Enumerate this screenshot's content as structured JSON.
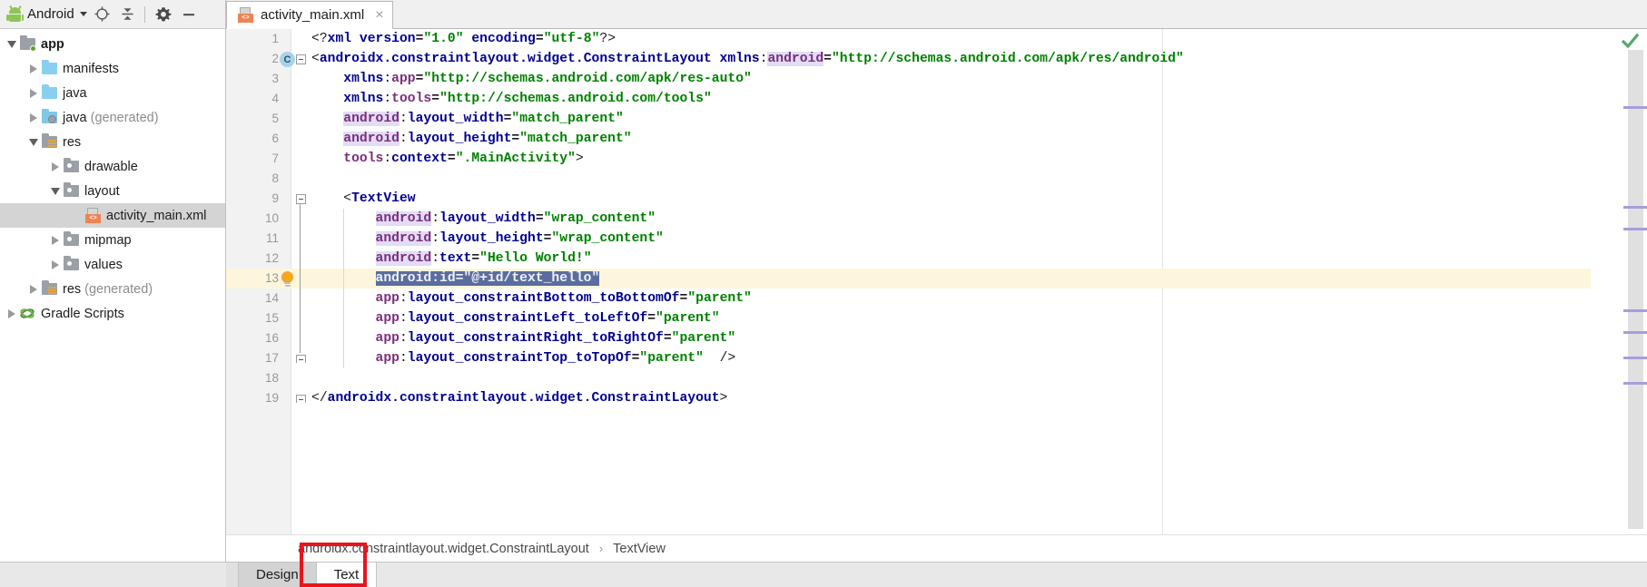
{
  "window": {
    "left_panel_title": "Android"
  },
  "project_toolbar": {
    "label": "Android",
    "icons": [
      "android-bot-icon",
      "chevron-down-icon",
      "locate-target-icon",
      "collapse-all-icon",
      "settings-gear-icon",
      "hide-panel-icon"
    ]
  },
  "project_tree": [
    {
      "label": "app",
      "sub": "",
      "depth": 0,
      "state": "expanded",
      "icon": "folder-module",
      "bold": true,
      "selected": false
    },
    {
      "label": "manifests",
      "sub": "",
      "depth": 1,
      "state": "collapsed",
      "icon": "folder-blue",
      "bold": false,
      "selected": false
    },
    {
      "label": "java",
      "sub": "",
      "depth": 1,
      "state": "collapsed",
      "icon": "folder-blue",
      "bold": false,
      "selected": false
    },
    {
      "label": "java",
      "sub": "(generated)",
      "depth": 1,
      "state": "collapsed",
      "icon": "folder-generated",
      "bold": false,
      "selected": false
    },
    {
      "label": "res",
      "sub": "",
      "depth": 1,
      "state": "expanded",
      "icon": "folder-res",
      "bold": false,
      "selected": false
    },
    {
      "label": "drawable",
      "sub": "",
      "depth": 2,
      "state": "collapsed",
      "icon": "folder-gray",
      "bold": false,
      "selected": false
    },
    {
      "label": "layout",
      "sub": "",
      "depth": 2,
      "state": "expanded",
      "icon": "folder-gray",
      "bold": false,
      "selected": false
    },
    {
      "label": "activity_main.xml",
      "sub": "",
      "depth": 3,
      "state": "leaf",
      "icon": "xml-layout-file",
      "bold": false,
      "selected": true
    },
    {
      "label": "mipmap",
      "sub": "",
      "depth": 2,
      "state": "collapsed",
      "icon": "folder-gray",
      "bold": false,
      "selected": false
    },
    {
      "label": "values",
      "sub": "",
      "depth": 2,
      "state": "collapsed",
      "icon": "folder-gray",
      "bold": false,
      "selected": false
    },
    {
      "label": "res",
      "sub": "(generated)",
      "depth": 1,
      "state": "collapsed",
      "icon": "folder-res",
      "bold": false,
      "selected": false
    },
    {
      "label": "Gradle Scripts",
      "sub": "",
      "depth": 0,
      "state": "collapsed",
      "icon": "gradle-elephant",
      "bold": false,
      "selected": false
    }
  ],
  "editor_tabs": [
    {
      "label": "activity_main.xml",
      "icon": "xml-layout-file",
      "close": "×",
      "active": true
    }
  ],
  "code": {
    "lines": [
      {
        "n": "1",
        "indent": 0,
        "tokens": [
          {
            "t": "<?",
            "c": "t-punct"
          },
          {
            "t": "xml",
            "c": "t-tag"
          },
          {
            "t": " ",
            "c": "t-punct"
          },
          {
            "t": "version",
            "c": "t-attr"
          },
          {
            "t": "=",
            "c": "t-eq"
          },
          {
            "t": "\"1.0\"",
            "c": "t-val"
          },
          {
            "t": " ",
            "c": "t-punct"
          },
          {
            "t": "encoding",
            "c": "t-attr"
          },
          {
            "t": "=",
            "c": "t-eq"
          },
          {
            "t": "\"utf-8\"",
            "c": "t-val"
          },
          {
            "t": "?>",
            "c": "t-punct"
          }
        ]
      },
      {
        "n": "2",
        "indent": 0,
        "tokens": [
          {
            "t": "<",
            "c": "t-punct"
          },
          {
            "t": "androidx.constraintlayout.widget.ConstraintLayout",
            "c": "t-tag"
          },
          {
            "t": " ",
            "c": "t-punct"
          },
          {
            "t": "xmlns",
            "c": "t-attr"
          },
          {
            "t": ":",
            "c": "t-punct"
          },
          {
            "t": "android",
            "c": "t-ns-hl"
          },
          {
            "t": "=",
            "c": "t-eq"
          },
          {
            "t": "\"http://schemas.android.com/apk/res/android\"",
            "c": "t-val"
          }
        ]
      },
      {
        "n": "3",
        "indent": 4,
        "tokens": [
          {
            "t": "xmlns",
            "c": "t-attr"
          },
          {
            "t": ":",
            "c": "t-punct"
          },
          {
            "t": "app",
            "c": "t-ns"
          },
          {
            "t": "=",
            "c": "t-eq"
          },
          {
            "t": "\"http://schemas.android.com/apk/res-auto\"",
            "c": "t-val"
          }
        ]
      },
      {
        "n": "4",
        "indent": 4,
        "tokens": [
          {
            "t": "xmlns",
            "c": "t-attr"
          },
          {
            "t": ":",
            "c": "t-punct"
          },
          {
            "t": "tools",
            "c": "t-ns"
          },
          {
            "t": "=",
            "c": "t-eq"
          },
          {
            "t": "\"http://schemas.android.com/tools\"",
            "c": "t-val"
          }
        ]
      },
      {
        "n": "5",
        "indent": 4,
        "tokens": [
          {
            "t": "android",
            "c": "t-ns-hl"
          },
          {
            "t": ":",
            "c": "t-punct"
          },
          {
            "t": "layout_width",
            "c": "t-attr"
          },
          {
            "t": "=",
            "c": "t-eq"
          },
          {
            "t": "\"match_parent\"",
            "c": "t-val"
          }
        ]
      },
      {
        "n": "6",
        "indent": 4,
        "tokens": [
          {
            "t": "android",
            "c": "t-ns-hl"
          },
          {
            "t": ":",
            "c": "t-punct"
          },
          {
            "t": "layout_height",
            "c": "t-attr"
          },
          {
            "t": "=",
            "c": "t-eq"
          },
          {
            "t": "\"match_parent\"",
            "c": "t-val"
          }
        ]
      },
      {
        "n": "7",
        "indent": 4,
        "tokens": [
          {
            "t": "tools",
            "c": "t-ns"
          },
          {
            "t": ":",
            "c": "t-punct"
          },
          {
            "t": "context",
            "c": "t-attr"
          },
          {
            "t": "=",
            "c": "t-eq"
          },
          {
            "t": "\".MainActivity\"",
            "c": "t-val"
          },
          {
            "t": ">",
            "c": "t-punct"
          }
        ]
      },
      {
        "n": "8",
        "indent": 0,
        "tokens": []
      },
      {
        "n": "9",
        "indent": 4,
        "tokens": [
          {
            "t": "<",
            "c": "t-punct"
          },
          {
            "t": "TextView",
            "c": "t-tag"
          }
        ]
      },
      {
        "n": "10",
        "indent": 8,
        "tokens": [
          {
            "t": "android",
            "c": "t-ns-hl"
          },
          {
            "t": ":",
            "c": "t-punct"
          },
          {
            "t": "layout_width",
            "c": "t-attr"
          },
          {
            "t": "=",
            "c": "t-eq"
          },
          {
            "t": "\"wrap_content\"",
            "c": "t-val"
          }
        ]
      },
      {
        "n": "11",
        "indent": 8,
        "tokens": [
          {
            "t": "android",
            "c": "t-ns-hl"
          },
          {
            "t": ":",
            "c": "t-punct"
          },
          {
            "t": "layout_height",
            "c": "t-attr"
          },
          {
            "t": "=",
            "c": "t-eq"
          },
          {
            "t": "\"wrap_content\"",
            "c": "t-val"
          }
        ]
      },
      {
        "n": "12",
        "indent": 8,
        "tokens": [
          {
            "t": "android",
            "c": "t-ns-hl"
          },
          {
            "t": ":",
            "c": "t-punct"
          },
          {
            "t": "text",
            "c": "t-attr"
          },
          {
            "t": "=",
            "c": "t-eq"
          },
          {
            "t": "\"Hello World!\"",
            "c": "t-val"
          }
        ]
      },
      {
        "n": "13",
        "indent": 8,
        "highlight": true,
        "tokens": [
          {
            "t": "android:id=\"@+id/text_hello\"",
            "c": "sel-text"
          }
        ]
      },
      {
        "n": "14",
        "indent": 8,
        "tokens": [
          {
            "t": "app",
            "c": "t-ns"
          },
          {
            "t": ":",
            "c": "t-punct"
          },
          {
            "t": "layout_constraintBottom_toBottomOf",
            "c": "t-attr"
          },
          {
            "t": "=",
            "c": "t-eq"
          },
          {
            "t": "\"parent\"",
            "c": "t-val"
          }
        ]
      },
      {
        "n": "15",
        "indent": 8,
        "tokens": [
          {
            "t": "app",
            "c": "t-ns"
          },
          {
            "t": ":",
            "c": "t-punct"
          },
          {
            "t": "layout_constraintLeft_toLeftOf",
            "c": "t-attr"
          },
          {
            "t": "=",
            "c": "t-eq"
          },
          {
            "t": "\"parent\"",
            "c": "t-val"
          }
        ]
      },
      {
        "n": "16",
        "indent": 8,
        "tokens": [
          {
            "t": "app",
            "c": "t-ns"
          },
          {
            "t": ":",
            "c": "t-punct"
          },
          {
            "t": "layout_constraintRight_toRightOf",
            "c": "t-attr"
          },
          {
            "t": "=",
            "c": "t-eq"
          },
          {
            "t": "\"parent\"",
            "c": "t-val"
          }
        ]
      },
      {
        "n": "17",
        "indent": 8,
        "tokens": [
          {
            "t": "app",
            "c": "t-ns"
          },
          {
            "t": ":",
            "c": "t-punct"
          },
          {
            "t": "layout_constraintTop_toTopOf",
            "c": "t-attr"
          },
          {
            "t": "=",
            "c": "t-eq"
          },
          {
            "t": "\"parent\"",
            "c": "t-val"
          },
          {
            "t": "  ",
            "c": "t-punct"
          },
          {
            "t": "/>",
            "c": "t-punct"
          }
        ]
      },
      {
        "n": "18",
        "indent": 0,
        "tokens": []
      },
      {
        "n": "19",
        "indent": 0,
        "tokens": [
          {
            "t": "</",
            "c": "t-punct"
          },
          {
            "t": "androidx.constraintlayout.widget.ConstraintLayout",
            "c": "t-tag"
          },
          {
            "t": ">",
            "c": "t-punct"
          }
        ]
      }
    ],
    "gutter_badge_line": "2",
    "gutter_badge_text": "C",
    "bulb_line": "13"
  },
  "breadcrumb": {
    "root": "androidx.constraintlayout.widget.ConstraintLayout",
    "separator": "›",
    "leaf": "TextView"
  },
  "bottom_tabs": [
    {
      "label": "Design",
      "active": false
    },
    {
      "label": "Text",
      "active": true
    }
  ],
  "annotation": {
    "highlight_color": "#e8141e",
    "target": "Text"
  },
  "status_indicators": {
    "inspection": "ok-check",
    "inspection_color": "#59a869",
    "marker_color": "#a99cdc",
    "marker_positions": [
      62,
      172,
      196,
      286,
      310,
      338,
      366
    ]
  }
}
